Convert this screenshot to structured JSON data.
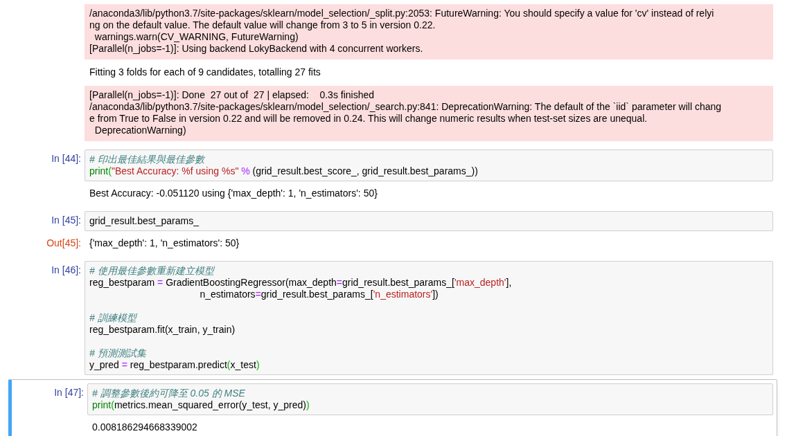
{
  "cells": [
    {
      "selected": false,
      "outputs": [
        {
          "kind": "stderr",
          "lines": [
            "/anaconda3/lib/python3.7/site-packages/sklearn/model_selection/_split.py:2053: FutureWarning: You should specify a value for 'cv' instead of relyi",
            "ng on the default value. The default value will change from 3 to 5 in version 0.22.",
            "  warnings.warn(CV_WARNING, FutureWarning)",
            "[Parallel(n_jobs=-1)]: Using backend LokyBackend with 4 concurrent workers."
          ]
        },
        {
          "kind": "stdout",
          "lines": [
            "Fitting 3 folds for each of 9 candidates, totalling 27 fits"
          ]
        },
        {
          "kind": "stderr",
          "lines": [
            "[Parallel(n_jobs=-1)]: Done  27 out of  27 | elapsed:    0.3s finished",
            "/anaconda3/lib/python3.7/site-packages/sklearn/model_selection/_search.py:841: DeprecationWarning: The default of the `iid` parameter will chang",
            "e from True to False in version 0.22 and will be removed in 0.24. This will change numeric results when test-set sizes are unequal.",
            "  DeprecationWarning)"
          ]
        }
      ]
    },
    {
      "prompt": "In [44]:",
      "selected": false,
      "code": [
        {
          "kind": "code",
          "tokens": [
            {
              "kind": "comment",
              "text": "# 印出最佳結果與最佳參數"
            }
          ]
        },
        {
          "kind": "code",
          "tokens": [
            {
              "kind": "builtin",
              "text": "print"
            },
            {
              "kind": "bracket",
              "text": "("
            },
            {
              "kind": "string",
              "text": "\"Best Accuracy: %f using %s\" "
            },
            {
              "kind": "operator",
              "text": "%"
            },
            {
              "kind": "text",
              "text": " (grid_result.best_score_, grid_result.best_params_))"
            }
          ]
        }
      ],
      "outputs": [
        {
          "kind": "stdout",
          "lines": [
            "Best Accuracy: -0.051120 using {'max_depth': 1, 'n_estimators': 50}"
          ]
        }
      ]
    },
    {
      "prompt": "In [45]:",
      "selected": false,
      "code": [
        {
          "kind": "code",
          "tokens": [
            {
              "kind": "text",
              "text": "grid_result.best_params_"
            }
          ]
        }
      ],
      "outputs": [
        {
          "kind": "result",
          "prompt": "Out[45]:",
          "lines": [
            "{'max_depth': 1, 'n_estimators': 50}"
          ]
        }
      ]
    },
    {
      "prompt": "In [46]:",
      "selected": false,
      "code": [
        {
          "kind": "code",
          "tokens": [
            {
              "kind": "comment",
              "text": "# 使用最佳參數重新建立模型"
            }
          ]
        },
        {
          "kind": "code",
          "tokens": [
            {
              "kind": "text",
              "text": "reg_bestparam "
            },
            {
              "kind": "operator",
              "text": "="
            },
            {
              "kind": "text",
              "text": " GradientBoostingRegressor(max_depth"
            },
            {
              "kind": "operator",
              "text": "="
            },
            {
              "kind": "text",
              "text": "grid_result.best_params_["
            },
            {
              "kind": "string",
              "text": "'max_depth'"
            },
            {
              "kind": "text",
              "text": "],"
            }
          ]
        },
        {
          "kind": "code",
          "tokens": [
            {
              "kind": "text",
              "text": "                                         n_estimators"
            },
            {
              "kind": "operator",
              "text": "="
            },
            {
              "kind": "text",
              "text": "grid_result.best_params_["
            },
            {
              "kind": "string",
              "text": "'n_estimators'"
            },
            {
              "kind": "text",
              "text": "])"
            }
          ]
        },
        {
          "kind": "blank"
        },
        {
          "kind": "code",
          "tokens": [
            {
              "kind": "comment",
              "text": "# 訓練模型"
            }
          ]
        },
        {
          "kind": "code",
          "tokens": [
            {
              "kind": "text",
              "text": "reg_bestparam.fit(x_train, y_train)"
            }
          ]
        },
        {
          "kind": "blank"
        },
        {
          "kind": "code",
          "tokens": [
            {
              "kind": "comment",
              "text": "# 預測測試集"
            }
          ]
        },
        {
          "kind": "code",
          "tokens": [
            {
              "kind": "text",
              "text": "y_pred "
            },
            {
              "kind": "operator",
              "text": "="
            },
            {
              "kind": "text",
              "text": " reg_bestparam.predict"
            },
            {
              "kind": "bracket",
              "text": "("
            },
            {
              "kind": "text",
              "text": "x_test"
            },
            {
              "kind": "bracket",
              "text": ")"
            }
          ]
        }
      ]
    },
    {
      "prompt": "In [47]:",
      "selected": true,
      "code": [
        {
          "kind": "code",
          "tokens": [
            {
              "kind": "comment",
              "text": "# 調整參數後約可降至 0.05 的 MSE"
            }
          ]
        },
        {
          "kind": "code",
          "tokens": [
            {
              "kind": "builtin",
              "text": "print"
            },
            {
              "kind": "bracket",
              "text": "("
            },
            {
              "kind": "text",
              "text": "metrics.mean_squared_error(y_test, y_pred)"
            },
            {
              "kind": "bracket",
              "text": ")"
            }
          ]
        }
      ],
      "outputs": [
        {
          "kind": "stdout",
          "lines": [
            "0.008186294668339002"
          ]
        }
      ]
    }
  ]
}
